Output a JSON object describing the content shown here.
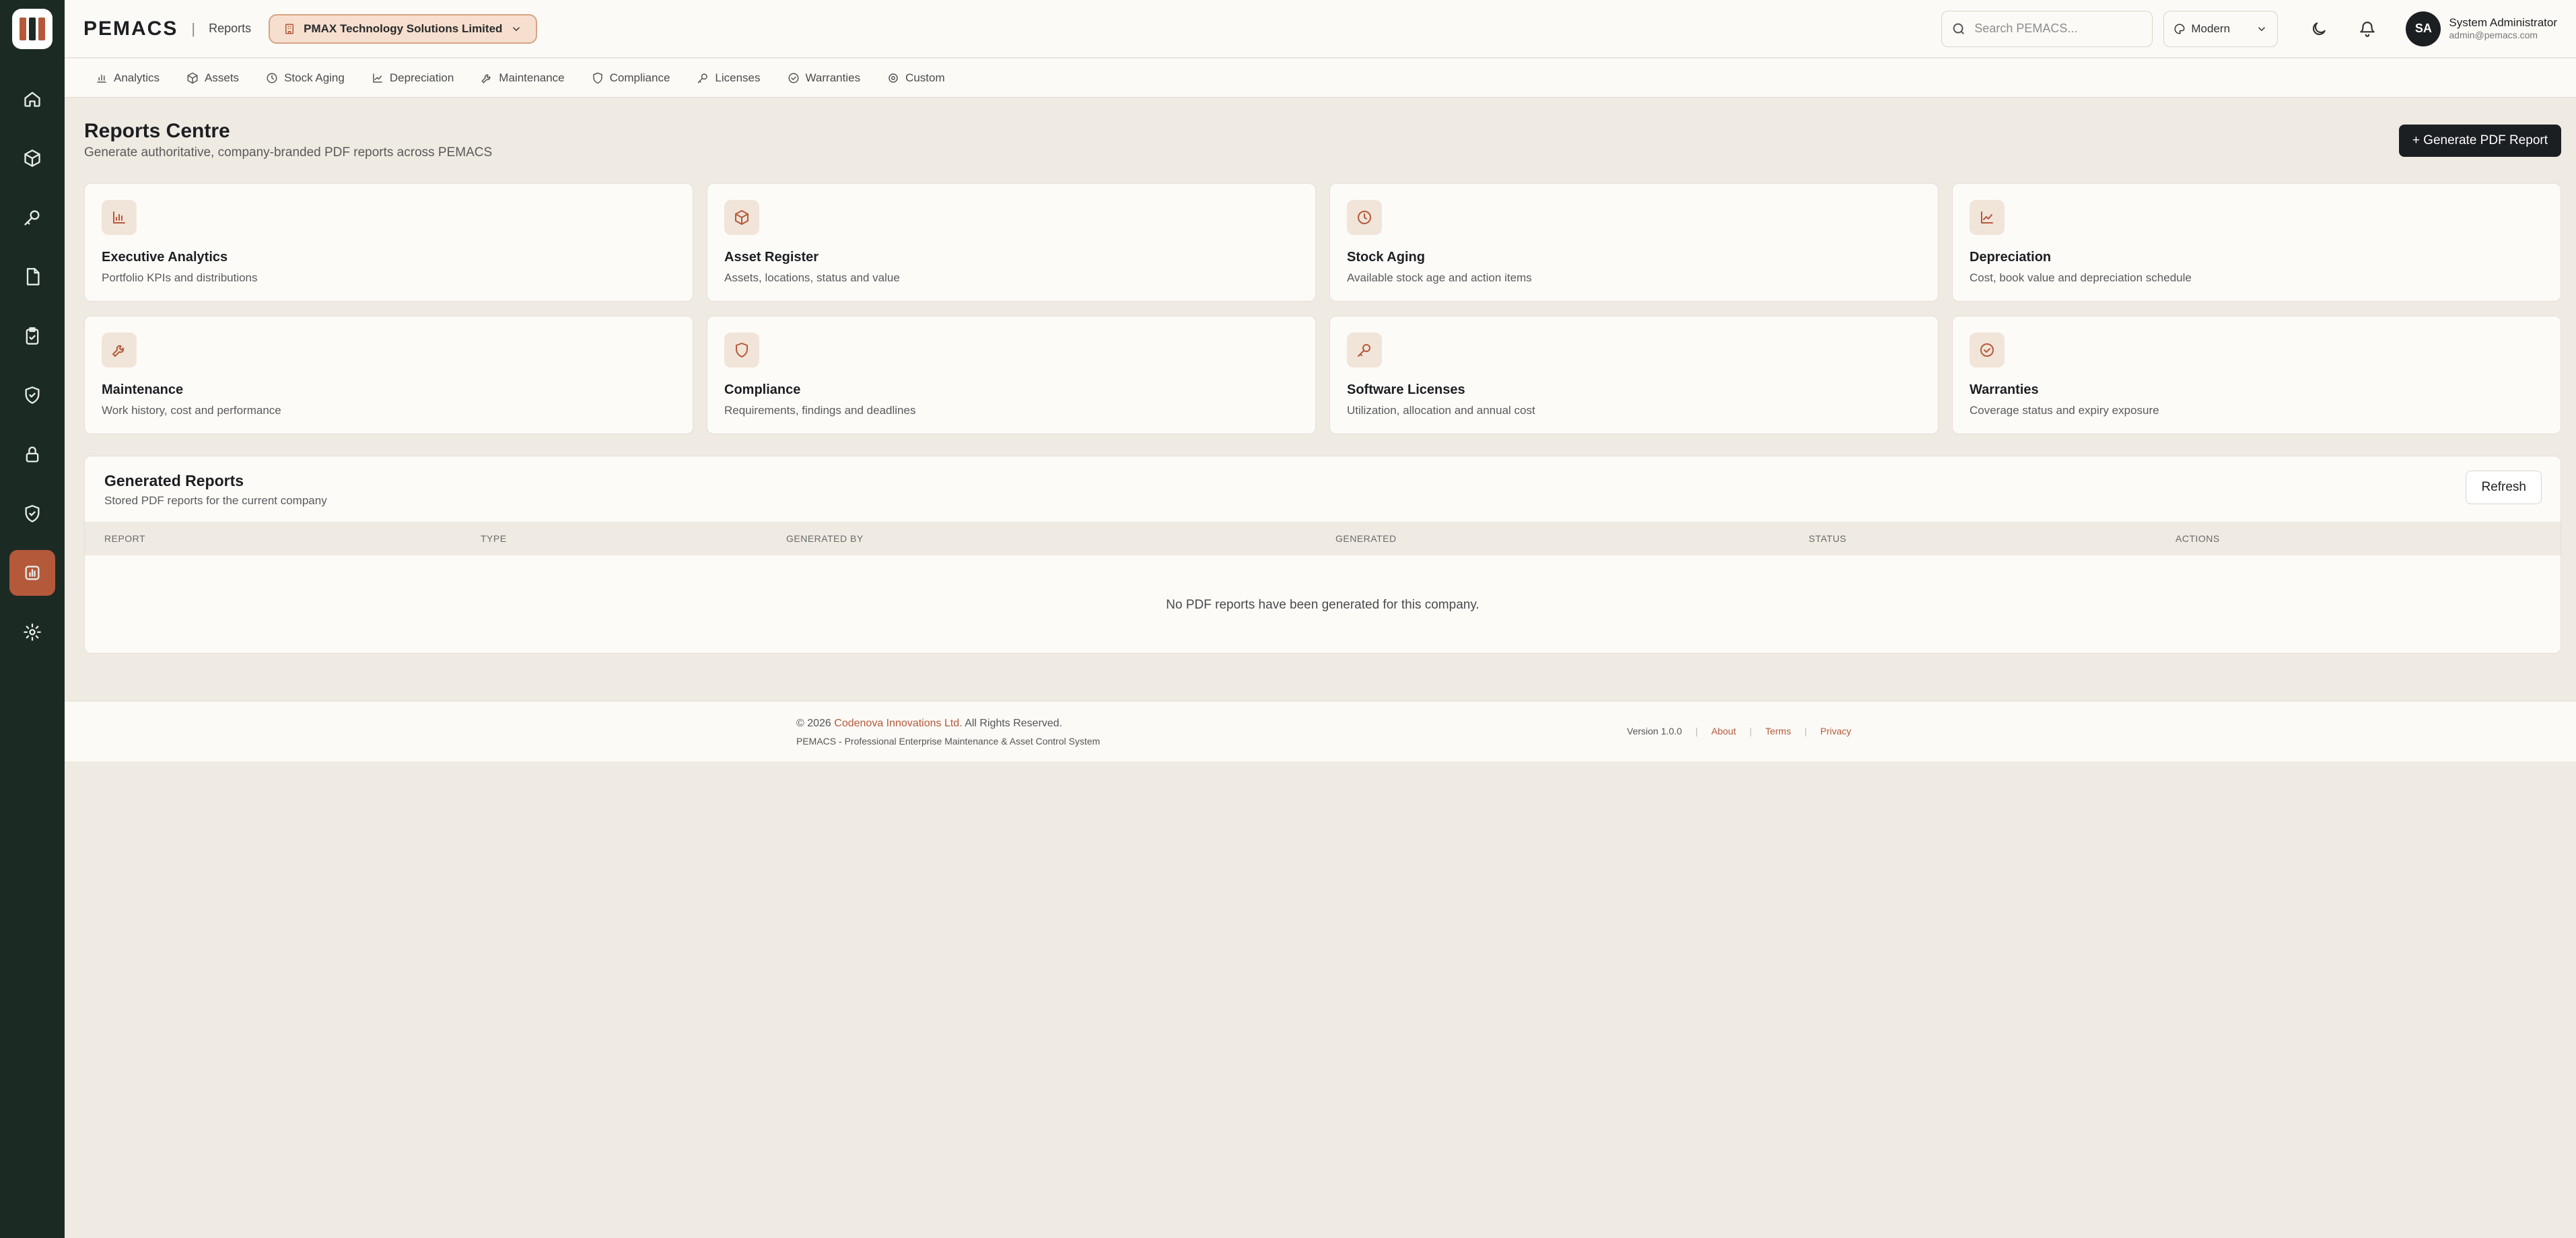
{
  "app": {
    "brand": "PEMACS",
    "separator": "|",
    "breadcrumb": "Reports",
    "company": "PMAX Technology Solutions Limited"
  },
  "header": {
    "search_placeholder": "Search PEMACS...",
    "theme": "Modern",
    "user_initials": "SA",
    "user_name": "System Administrator",
    "user_email": "admin@pemacs.com"
  },
  "sidebar": {
    "items": [
      {
        "icon": "home-icon"
      },
      {
        "icon": "box-icon"
      },
      {
        "icon": "key-icon"
      },
      {
        "icon": "document-icon"
      },
      {
        "icon": "clipboard-check-icon"
      },
      {
        "icon": "shield-check-icon"
      },
      {
        "icon": "lock-icon"
      },
      {
        "icon": "shield-icon"
      },
      {
        "icon": "bar-chart-icon",
        "active": true
      },
      {
        "icon": "gear-icon"
      }
    ]
  },
  "subnav": {
    "tabs": [
      {
        "label": "Analytics",
        "icon": "bar-chart-icon"
      },
      {
        "label": "Assets",
        "icon": "box-icon"
      },
      {
        "label": "Stock Aging",
        "icon": "clock-icon"
      },
      {
        "label": "Depreciation",
        "icon": "line-chart-icon"
      },
      {
        "label": "Maintenance",
        "icon": "wrench-icon"
      },
      {
        "label": "Compliance",
        "icon": "shield-icon"
      },
      {
        "label": "Licenses",
        "icon": "key-icon"
      },
      {
        "label": "Warranties",
        "icon": "check-circle-icon"
      },
      {
        "label": "Custom",
        "icon": "gear-icon"
      }
    ]
  },
  "page": {
    "title": "Reports Centre",
    "subtitle": "Generate authoritative, company-branded PDF reports across PEMACS",
    "generate_button": "+ Generate PDF Report"
  },
  "cards": [
    {
      "title": "Executive Analytics",
      "desc": "Portfolio KPIs and distributions",
      "icon": "bar-chart-icon"
    },
    {
      "title": "Asset Register",
      "desc": "Assets, locations, status and value",
      "icon": "box-icon"
    },
    {
      "title": "Stock Aging",
      "desc": "Available stock age and action items",
      "icon": "clock-icon"
    },
    {
      "title": "Depreciation",
      "desc": "Cost, book value and depreciation schedule",
      "icon": "line-chart-icon"
    },
    {
      "title": "Maintenance",
      "desc": "Work history, cost and performance",
      "icon": "wrench-icon"
    },
    {
      "title": "Compliance",
      "desc": "Requirements, findings and deadlines",
      "icon": "shield-icon"
    },
    {
      "title": "Software Licenses",
      "desc": "Utilization, allocation and annual cost",
      "icon": "key-icon"
    },
    {
      "title": "Warranties",
      "desc": "Coverage status and expiry exposure",
      "icon": "check-circle-icon"
    }
  ],
  "generated_reports": {
    "title": "Generated Reports",
    "subtitle": "Stored PDF reports for the current company",
    "refresh_label": "Refresh",
    "columns": [
      "REPORT",
      "TYPE",
      "GENERATED BY",
      "GENERATED",
      "STATUS",
      "ACTIONS"
    ],
    "empty_message": "No PDF reports have been generated for this company."
  },
  "footer": {
    "copyright_prefix": "© 2026",
    "company_link": "Codenova Innovations Ltd.",
    "rights": "All Rights Reserved.",
    "tagline": "PEMACS - Professional Enterprise Maintenance & Asset Control System",
    "version": "Version 1.0.0",
    "about": "About",
    "terms": "Terms",
    "privacy": "Privacy",
    "divider": "|"
  },
  "colors": {
    "accent": "#b4593a",
    "sidebar": "#1c2a24",
    "background": "#efeae2"
  }
}
